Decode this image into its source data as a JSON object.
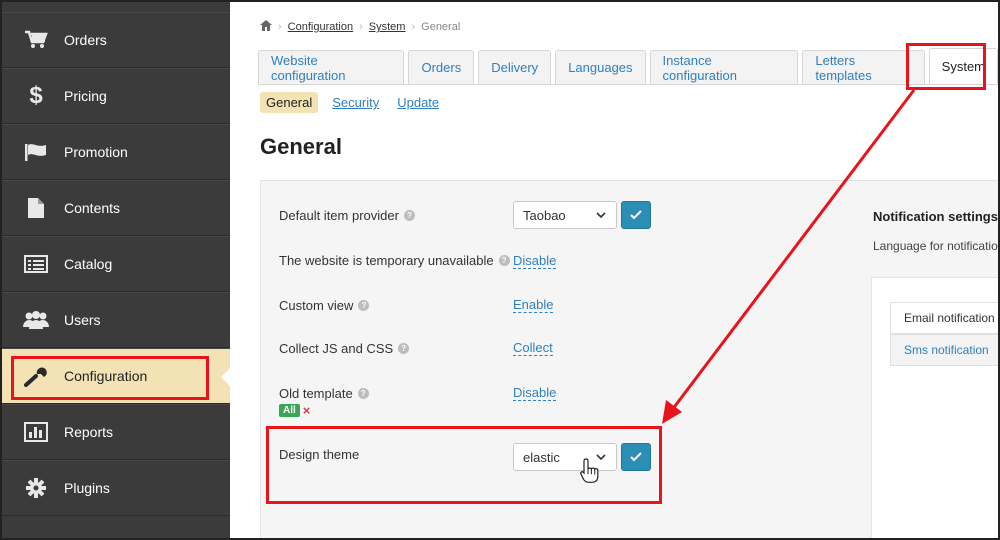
{
  "sidebar": {
    "items": [
      {
        "label": "Orders",
        "icon": "cart-icon"
      },
      {
        "label": "Pricing",
        "icon": "dollar-icon"
      },
      {
        "label": "Promotion",
        "icon": "flag-icon"
      },
      {
        "label": "Contents",
        "icon": "document-icon"
      },
      {
        "label": "Catalog",
        "icon": "list-icon"
      },
      {
        "label": "Users",
        "icon": "users-icon"
      },
      {
        "label": "Configuration",
        "icon": "wrench-icon",
        "active": true
      },
      {
        "label": "Reports",
        "icon": "bar-chart-icon"
      },
      {
        "label": "Plugins",
        "icon": "gear-icon"
      }
    ]
  },
  "breadcrumb": {
    "home_icon": "home-icon",
    "items": [
      "Configuration",
      "System"
    ],
    "current": "General"
  },
  "tabs": [
    {
      "label": "Website configuration"
    },
    {
      "label": "Orders"
    },
    {
      "label": "Delivery"
    },
    {
      "label": "Languages"
    },
    {
      "label": "Instance configuration"
    },
    {
      "label": "Letters templates"
    },
    {
      "label": "System",
      "active": true
    }
  ],
  "subtabs": [
    {
      "label": "General",
      "active": true
    },
    {
      "label": "Security"
    },
    {
      "label": "Update"
    }
  ],
  "page_title": "General",
  "settings": {
    "default_provider": {
      "label": "Default item provider",
      "value": "Taobao"
    },
    "temp_unavailable": {
      "label": "The website is temporary unavailable",
      "action": "Disable"
    },
    "custom_view": {
      "label": "Custom view",
      "action": "Enable"
    },
    "collect": {
      "label": "Collect JS and CSS",
      "action": "Collect"
    },
    "old_template": {
      "label": "Old template",
      "action": "Disable",
      "badge": "All",
      "remove": "×"
    },
    "design_theme": {
      "label": "Design theme",
      "value": "elastic"
    }
  },
  "notifications": {
    "title": "Notification settings",
    "subtitle": "Language for notificatio",
    "items": [
      "Email notification",
      "Sms notification"
    ]
  },
  "colors": {
    "accent": "#2b8fb5",
    "highlight": "#e8141c",
    "active_bg": "#f2e2b4",
    "sidebar_bg": "#3b3b3b"
  }
}
